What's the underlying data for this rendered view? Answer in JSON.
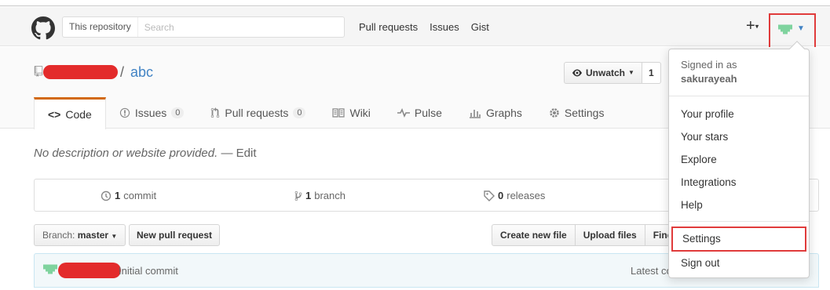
{
  "header": {
    "search_scope": "This repository",
    "search_placeholder": "Search",
    "nav": [
      "Pull requests",
      "Issues",
      "Gist"
    ],
    "plus": "+"
  },
  "repo": {
    "slash": "/",
    "name": "abc",
    "watch_label": "Unwatch",
    "watch_count": "1"
  },
  "tabs": [
    {
      "label": "Code"
    },
    {
      "label": "Issues",
      "count": "0"
    },
    {
      "label": "Pull requests",
      "count": "0"
    },
    {
      "label": "Wiki"
    },
    {
      "label": "Pulse"
    },
    {
      "label": "Graphs"
    },
    {
      "label": "Settings"
    }
  ],
  "description": {
    "text": "No description or website provided.",
    "dash": "—",
    "edit": "Edit"
  },
  "summary": {
    "commits_num": "1",
    "commits_label": "commit",
    "branches_num": "1",
    "branches_label": "branch",
    "releases_num": "0",
    "releases_label": "releases"
  },
  "filebar": {
    "branch_prefix": "Branch:",
    "branch_name": "master",
    "new_pr": "New pull request",
    "create_file": "Create new file",
    "upload_files": "Upload files",
    "find_file": "Find"
  },
  "commit": {
    "message": "Initial commit",
    "latest": "Latest co"
  },
  "user_menu": {
    "signed_in_as": "Signed in as",
    "username": "sakurayeah",
    "items_group1": [
      "Your profile",
      "Your stars",
      "Explore",
      "Integrations",
      "Help"
    ],
    "settings": "Settings",
    "sign_out": "Sign out"
  },
  "colors": {
    "accent_link": "#4183c4",
    "highlight_box": "#e03b3b",
    "active_tab_border": "#d26911",
    "redaction": "#e32b2b"
  }
}
